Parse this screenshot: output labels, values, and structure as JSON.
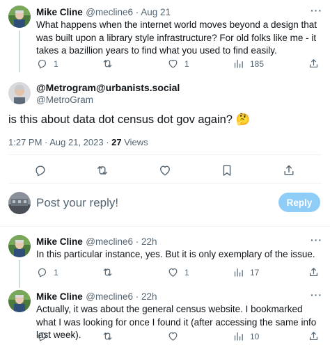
{
  "tweet1": {
    "name": "Mike Cline",
    "handle_date": "@mecline6 · Aug 21",
    "text": "What happens when the internet world moves beyond a design that was built upon a library style infrastructure?  For old folks like me - it takes a bazillion years to find what you used to find easily.",
    "replies": "1",
    "retweets": "",
    "likes": "1",
    "views": "185"
  },
  "main": {
    "name": "@Metrogram@urbanists.social",
    "handle": "@MetroGram",
    "text": "is this about data dot census dot gov again? 🤔",
    "timestamp": "1:27 PM · Aug 21, 2023 · ",
    "views_count": "27",
    "views_label": " Views"
  },
  "compose": {
    "placeholder": "Post your reply!",
    "button": "Reply"
  },
  "tweet2": {
    "name": "Mike Cline",
    "handle_date": "@mecline6 · 22h",
    "text": "In this particular instance, yes.  But it is only exemplary of the issue.",
    "replies": "1",
    "retweets": "",
    "likes": "1",
    "views": "17"
  },
  "tweet3": {
    "name": "Mike Cline",
    "handle_date": "@mecline6 · 22h",
    "text": "Actually, it was about the general census website. I bookmarked what I was looking for once I found it (after accessing the same info last week).",
    "replies": "",
    "retweets": "",
    "likes": "",
    "views": "10"
  },
  "more_glyph": "···",
  "colors": {
    "accent": "#1d9bf0",
    "reply_button_disabled": "#8ecdf8",
    "muted": "#536471"
  },
  "icons": [
    "reply-icon",
    "retweet-icon",
    "like-icon",
    "views-icon",
    "share-icon",
    "bookmark-icon",
    "more-icon"
  ]
}
